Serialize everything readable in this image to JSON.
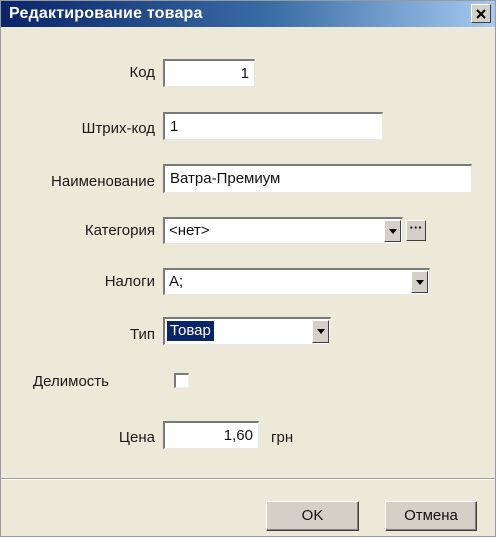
{
  "window": {
    "title": "Редактирование товара"
  },
  "icons": {
    "close": "close-icon",
    "dropdown": "chevron-down-icon"
  },
  "form": {
    "code": {
      "label": "Код",
      "value": "1"
    },
    "barcode": {
      "label": "Штрих-код",
      "value": "1"
    },
    "name": {
      "label": "Наименование",
      "value": "Ватра-Премиум"
    },
    "category": {
      "label": "Категория",
      "value": "<нет>",
      "browse_label": "···"
    },
    "taxes": {
      "label": "Налоги",
      "value": "А;"
    },
    "type": {
      "label": "Тип",
      "value": "Товар"
    },
    "divisible": {
      "label": "Делимость",
      "checked": false
    },
    "price": {
      "label": "Цена",
      "value": "1,60",
      "unit": "грн"
    }
  },
  "buttons": {
    "ok": "OK",
    "cancel": "Отмена"
  },
  "colors": {
    "title_start": "#0a246a",
    "title_end": "#a6caf0",
    "dialog_bg": "#ece9d8",
    "selection": "#0a246a"
  }
}
